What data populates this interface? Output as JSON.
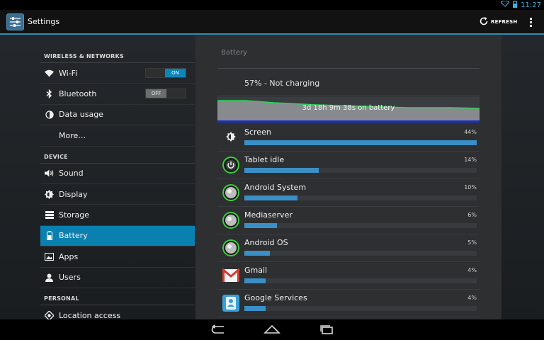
{
  "status_bar": {
    "time": "11:27"
  },
  "action_bar": {
    "title": "Settings",
    "refresh_label": "REFRESH"
  },
  "sidebar": {
    "sections": [
      {
        "header": "WIRELESS & NETWORKS",
        "items": [
          {
            "label": "Wi-Fi",
            "icon": "wifi-icon",
            "toggle": "ON"
          },
          {
            "label": "Bluetooth",
            "icon": "bluetooth-icon",
            "toggle": "OFF"
          },
          {
            "label": "Data usage",
            "icon": "data-usage-icon"
          },
          {
            "label": "More…"
          }
        ]
      },
      {
        "header": "DEVICE",
        "items": [
          {
            "label": "Sound",
            "icon": "speaker-icon"
          },
          {
            "label": "Display",
            "icon": "brightness-icon"
          },
          {
            "label": "Storage",
            "icon": "storage-icon"
          },
          {
            "label": "Battery",
            "icon": "battery-icon",
            "selected": true
          },
          {
            "label": "Apps",
            "icon": "apps-icon"
          },
          {
            "label": "Users",
            "icon": "user-icon"
          }
        ]
      },
      {
        "header": "PERSONAL",
        "items": [
          {
            "label": "Location access",
            "icon": "location-icon"
          }
        ]
      }
    ]
  },
  "battery": {
    "section_title": "Battery",
    "status": "57% - Not charging",
    "graph_label": "3d 18h 9m 38s on battery",
    "usage": [
      {
        "name": "Screen",
        "percent": "44%",
        "fraction": 1.0,
        "icon": "screen-brightness-icon"
      },
      {
        "name": "Tablet idle",
        "percent": "14%",
        "fraction": 0.32,
        "icon": "tablet-idle-icon"
      },
      {
        "name": "Android System",
        "percent": "10%",
        "fraction": 0.23,
        "icon": "android-system-icon"
      },
      {
        "name": "Mediaserver",
        "percent": "6%",
        "fraction": 0.14,
        "icon": "mediaserver-icon"
      },
      {
        "name": "Android OS",
        "percent": "5%",
        "fraction": 0.11,
        "icon": "android-os-icon"
      },
      {
        "name": "Gmail",
        "percent": "4%",
        "fraction": 0.09,
        "icon": "gmail-icon"
      },
      {
        "name": "Google Services",
        "percent": "4%",
        "fraction": 0.09,
        "icon": "google-services-icon"
      }
    ]
  },
  "colors": {
    "accent": "#33b5e5",
    "selected": "#0a80b0",
    "bar": "#3a8fc7",
    "graph_line": "#2fd35a",
    "graph_base": "#1a2ec8"
  }
}
